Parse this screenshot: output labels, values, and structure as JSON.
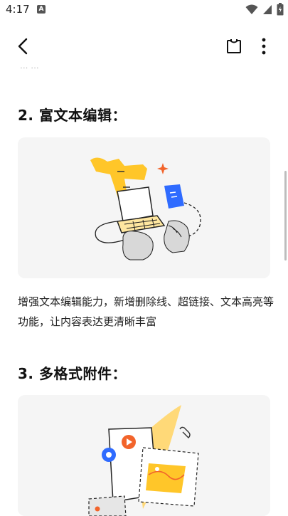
{
  "status_bar": {
    "time": "4:17",
    "notification_letter": "A"
  },
  "toolbar": {
    "back_icon": "chevron-left-icon",
    "clip_icon": "clipboard-icon",
    "more_icon": "more-vertical-icon"
  },
  "partial_previous_text": "... ...",
  "sections": [
    {
      "title": "2. 富文本编辑：",
      "illustration": "rich-text-editing-illustration",
      "description": "增强文本编辑能力，新增删除线、超链接、文本高亮等功能，让内容表达更清晰丰富"
    },
    {
      "title": "3. 多格式附件：",
      "illustration": "multi-format-attachments-illustration"
    }
  ],
  "colors": {
    "accent_yellow": "#FFC629",
    "blue": "#2F6BFF",
    "orange": "#F2642B",
    "card_bg": "#F5F5F5"
  }
}
